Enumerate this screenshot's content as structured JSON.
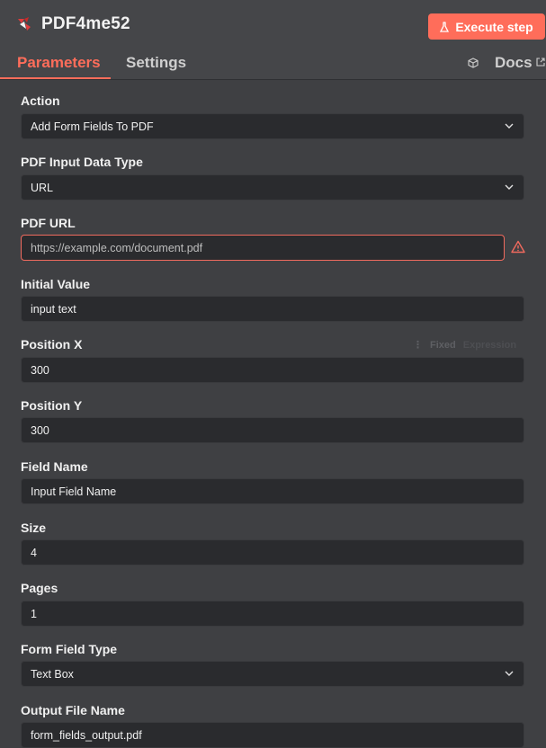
{
  "header": {
    "node_title": "PDF4me52",
    "execute_label": "Execute step",
    "tabs": [
      {
        "label": "Parameters",
        "active": true
      },
      {
        "label": "Settings",
        "active": false
      }
    ],
    "docs_label": "Docs"
  },
  "accent_color": "#ff6d5a",
  "fields": {
    "action": {
      "label": "Action",
      "value": "Add Form Fields To PDF"
    },
    "pdf_input_data_type": {
      "label": "PDF Input Data Type",
      "value": "URL"
    },
    "pdf_url": {
      "label": "PDF URL",
      "value": "https://example.com/document.pdf"
    },
    "initial_value": {
      "label": "Initial Value",
      "value": "input text"
    },
    "position_x": {
      "label": "Position X",
      "value": "300",
      "toggle_fixed": "Fixed",
      "toggle_expression": "Expression"
    },
    "position_y": {
      "label": "Position Y",
      "value": "300"
    },
    "field_name": {
      "label": "Field Name",
      "value": "Input Field Name"
    },
    "size": {
      "label": "Size",
      "value": "4"
    },
    "pages": {
      "label": "Pages",
      "value": "1"
    },
    "form_field_type": {
      "label": "Form Field Type",
      "value": "Text Box"
    },
    "output_file_name": {
      "label": "Output File Name",
      "value": "form_fields_output.pdf"
    }
  }
}
